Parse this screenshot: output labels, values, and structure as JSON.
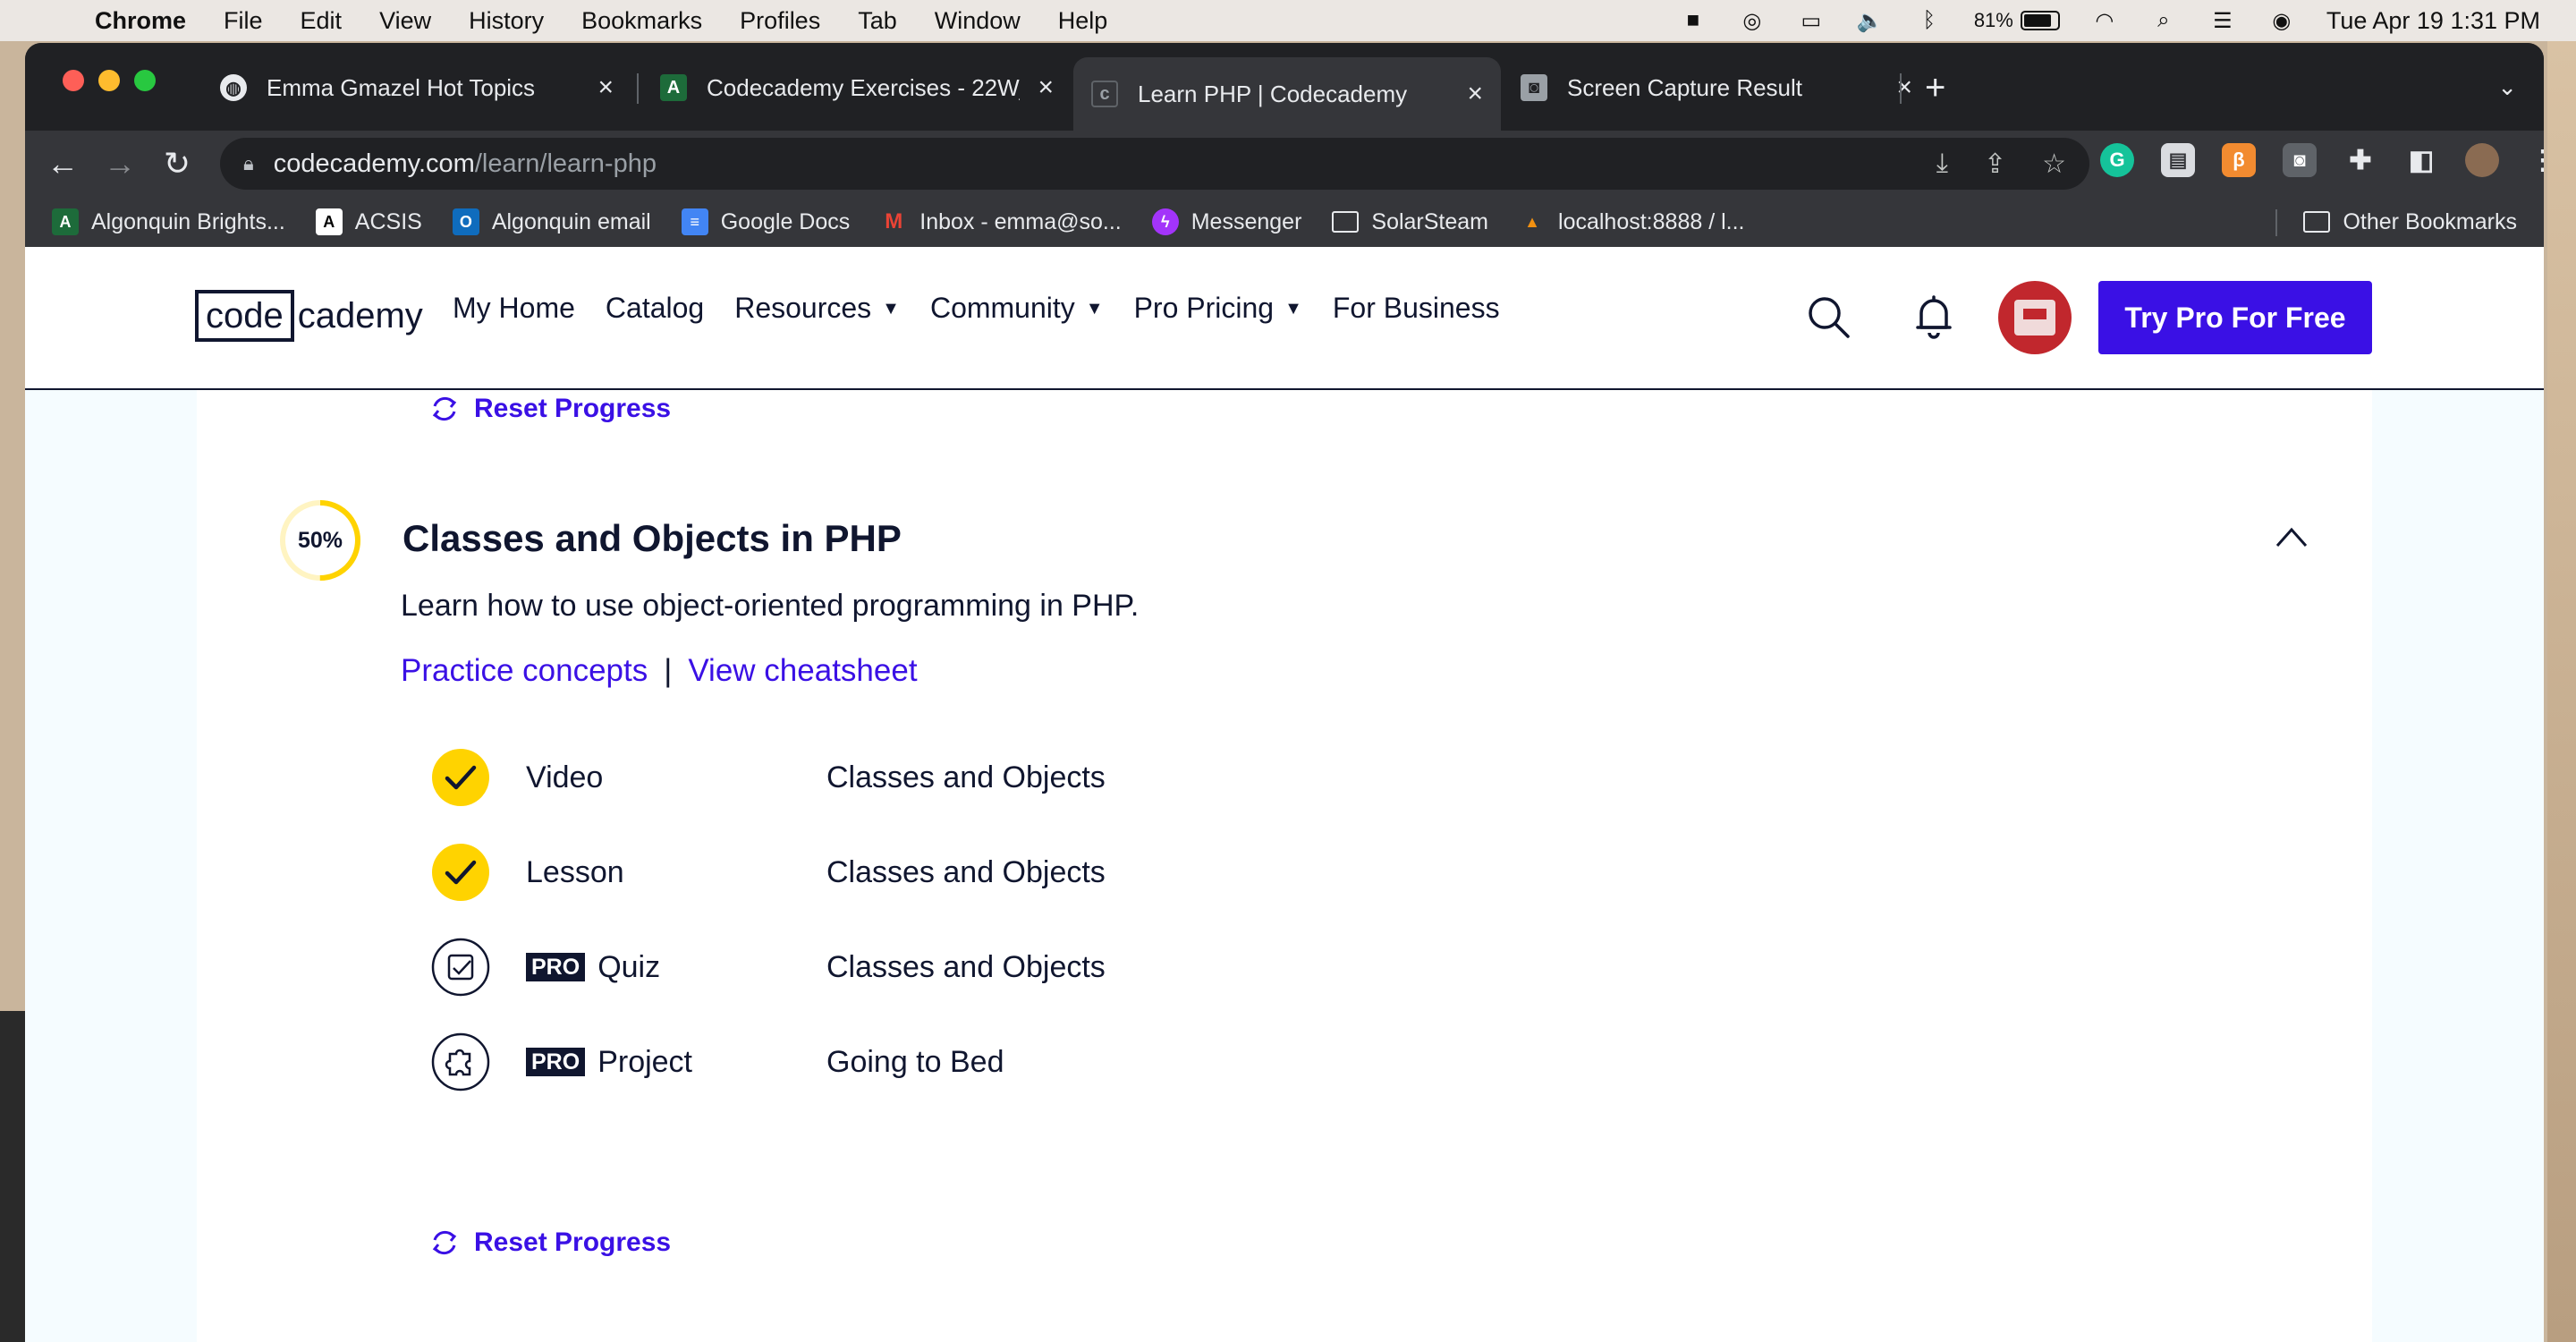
{
  "menubar": {
    "app": "Chrome",
    "items": [
      "File",
      "Edit",
      "View",
      "History",
      "Bookmarks",
      "Profiles",
      "Tab",
      "Window",
      "Help"
    ],
    "battery": "81%",
    "datetime": "Tue Apr 19  1:31 PM"
  },
  "tabs": [
    {
      "label": "Emma Gmazel Hot Topics",
      "icon": "globe-icon"
    },
    {
      "label": "Codecademy Exercises - 22W_",
      "icon": "algonquin-icon"
    },
    {
      "label": "Learn PHP | Codecademy",
      "icon": "codecademy-icon",
      "active": true
    },
    {
      "label": "Screen Capture Result",
      "icon": "camera-icon"
    }
  ],
  "omnibox": {
    "domain": "codecademy.com",
    "path": "/learn/learn-php"
  },
  "bookmarks": [
    {
      "label": "Algonquin Brights...",
      "icon": "algonquin-icon"
    },
    {
      "label": "ACSIS",
      "icon": "acsis-icon"
    },
    {
      "label": "Algonquin email",
      "icon": "outlook-icon"
    },
    {
      "label": "Google Docs",
      "icon": "docs-icon"
    },
    {
      "label": "Inbox - emma@so...",
      "icon": "gmail-icon"
    },
    {
      "label": "Messenger",
      "icon": "messenger-icon"
    },
    {
      "label": "SolarSteam",
      "icon": "folder-icon"
    },
    {
      "label": "localhost:8888 / l...",
      "icon": "phpmyadmin-icon"
    }
  ],
  "other_bookmarks": "Other Bookmarks",
  "header": {
    "logo_box": "code",
    "logo_rest": "cademy",
    "nav": {
      "my_home": "My Home",
      "catalog": "Catalog",
      "resources": "Resources",
      "community": "Community",
      "pro_pricing": "Pro Pricing",
      "for_business": "For Business"
    },
    "cta": "Try Pro For Free"
  },
  "module": {
    "reset_top": "Reset Progress",
    "progress": "50%",
    "progress_value": 0.5,
    "title": "Classes and Objects in PHP",
    "description": "Learn how to use object-oriented programming in PHP.",
    "practice_link": "Practice concepts",
    "separator": "|",
    "cheatsheet_link": "View cheatsheet",
    "items": [
      {
        "kind": "Video",
        "name": "Classes and Objects",
        "status": "complete",
        "pro": false
      },
      {
        "kind": "Lesson",
        "name": "Classes and Objects",
        "status": "complete",
        "pro": false
      },
      {
        "kind": "Quiz",
        "name": "Classes and Objects",
        "status": "quiz-icon",
        "pro": true
      },
      {
        "kind": "Project",
        "name": "Going to Bed",
        "status": "project-icon",
        "pro": true
      }
    ],
    "pro_badge": "PRO",
    "reset_bottom": "Reset Progress"
  },
  "colors": {
    "brand_primary": "#3a10e5",
    "navy": "#10162f",
    "complete_yellow": "#ffd300",
    "page_bg": "#f5fcff"
  }
}
